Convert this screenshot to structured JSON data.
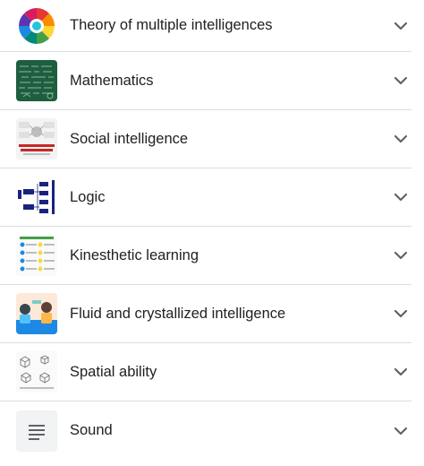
{
  "items": [
    {
      "label": "Theory of multiple intelligences",
      "thumb_icon": "multiple-intelligences-wheel-thumbnail"
    },
    {
      "label": "Mathematics",
      "thumb_icon": "chalkboard-equations-thumbnail"
    },
    {
      "label": "Social intelligence",
      "thumb_icon": "social-intelligence-infographic-thumbnail"
    },
    {
      "label": "Logic",
      "thumb_icon": "logic-flowchart-thumbnail"
    },
    {
      "label": "Kinesthetic learning",
      "thumb_icon": "kinesthetic-learning-infographic-thumbnail"
    },
    {
      "label": "Fluid and crystallized intelligence",
      "thumb_icon": "fluid-crystallized-illustration-thumbnail"
    },
    {
      "label": "Spatial ability",
      "thumb_icon": "spatial-ability-test-thumbnail"
    },
    {
      "label": "Sound",
      "thumb_icon": "article-lines-icon"
    }
  ],
  "expand_icon": "chevron-down-icon",
  "colors": {
    "text": "#202124",
    "divider": "#dadce0",
    "chevron": "#5f6368"
  }
}
